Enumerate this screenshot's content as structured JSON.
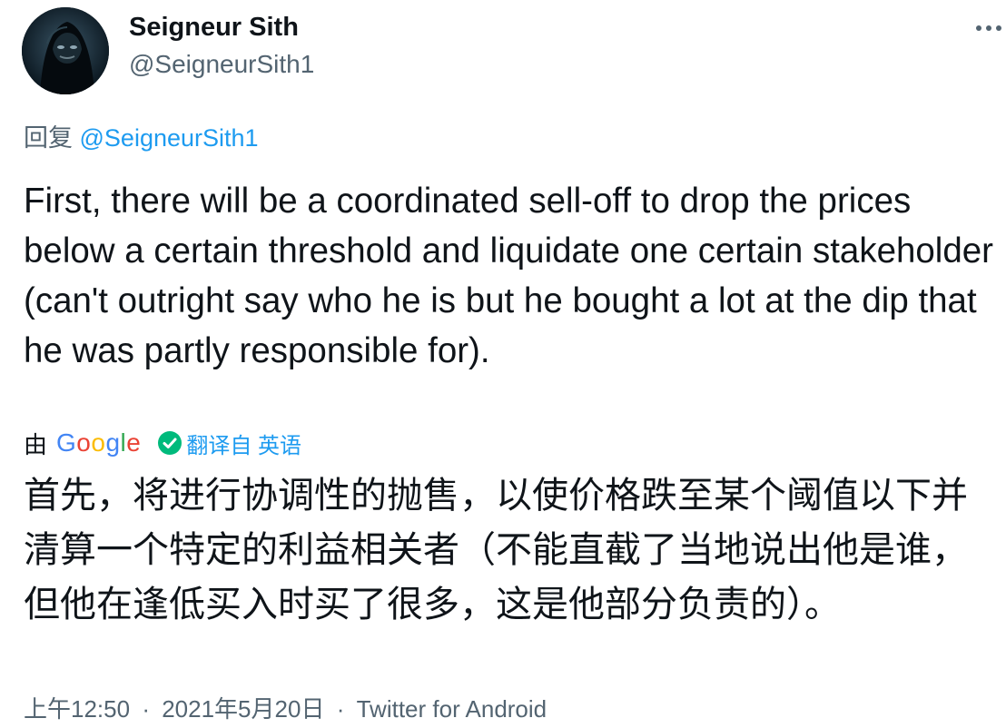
{
  "author": {
    "display_name": "Seigneur Sith",
    "handle": "@SeigneurSith1",
    "avatar_icon": "hooded-figure-avatar"
  },
  "more_icon": "more-dots-icon",
  "reply": {
    "prefix": "回复",
    "mention": "@SeigneurSith1"
  },
  "tweet_text": "First, there will be a coordinated sell-off to drop the prices below a certain threshold and liquidate one certain stakeholder (can't outright say who he is but he bought a lot at the dip that he was partly responsible for).",
  "translation": {
    "by_label": "由",
    "provider": "Google",
    "check_icon": "check-circle-icon",
    "translated_from_label": "翻译自 英语",
    "text": "首先，将进行协调性的抛售，以使价格跌至某个阈值以下并清算一个特定的利益相关者（不能直截了当地说出他是谁，但他在逢低买入时买了很多，这是他部分负责的）。"
  },
  "meta": {
    "time": "上午12:50",
    "date": "2021年5月20日",
    "separator": "·",
    "source": "Twitter for Android"
  },
  "colors": {
    "text": "#0f1419",
    "secondary": "#536471",
    "link": "#1d9bf0",
    "check": "#00ba7c"
  }
}
